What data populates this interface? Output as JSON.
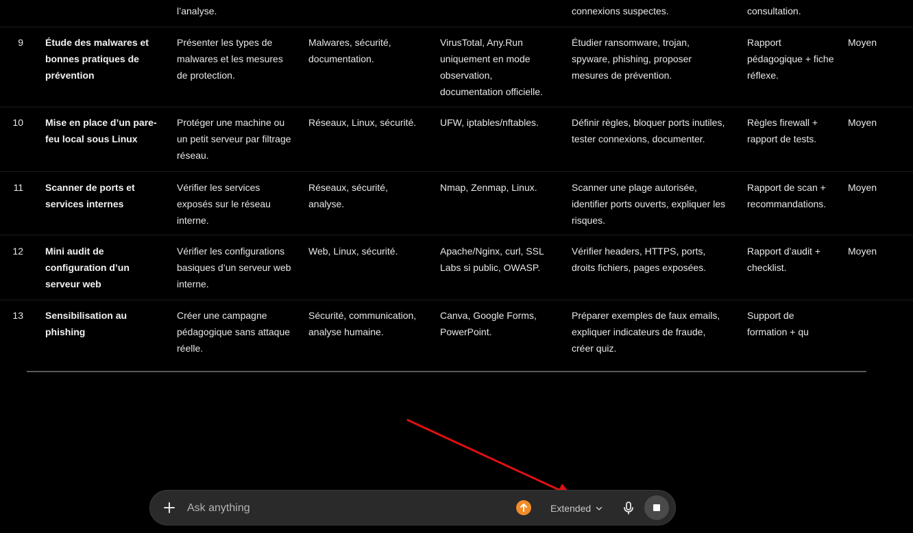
{
  "table": {
    "top_row": {
      "objective": "l’analyse.",
      "steps": "connexions suspectes.",
      "deliverable": "consultation."
    },
    "rows": [
      {
        "num": "9",
        "title": "Étude des malwares et bonnes pratiques de prévention",
        "objective": "Présenter les types de malwares et les mesures de protection.",
        "domains": "Malwares, sécurité, documentation.",
        "tools": "VirusTotal, Any.Run uniquement en mode observation, documentation officielle.",
        "steps": "Étudier ransomware, trojan, spyware, phishing, proposer mesures de prévention.",
        "deliverable": "Rapport pédagogique + fiche réflexe.",
        "level": "Moyen"
      },
      {
        "num": "10",
        "title": "Mise en place d’un pare-feu local sous Linux",
        "objective": "Protéger une machine ou un petit serveur par filtrage réseau.",
        "domains": "Réseaux, Linux, sécurité.",
        "tools": "UFW, iptables/nftables.",
        "steps": "Définir règles, bloquer ports inutiles, tester connexions, documenter.",
        "deliverable": "Règles firewall + rapport de tests.",
        "level": "Moyen"
      },
      {
        "num": "11",
        "title": "Scanner de ports et services internes",
        "objective": "Vérifier les services exposés sur le réseau interne.",
        "domains": "Réseaux, sécurité, analyse.",
        "tools": "Nmap, Zenmap, Linux.",
        "steps": "Scanner une plage autorisée, identifier ports ouverts, expliquer les risques.",
        "deliverable": "Rapport de scan + recommandations.",
        "level": "Moyen"
      },
      {
        "num": "12",
        "title": "Mini audit de configuration d’un serveur web",
        "objective": "Vérifier les configurations basiques d’un serveur web interne.",
        "domains": "Web, Linux, sécurité.",
        "tools": "Apache/Nginx, curl, SSL Labs si public, OWASP.",
        "steps": "Vérifier headers, HTTPS, ports, droits fichiers, pages exposées.",
        "deliverable": "Rapport d’audit + checklist.",
        "level": "Moyen"
      },
      {
        "num": "13",
        "title": "Sensibilisation au phishing",
        "objective": "Créer une campagne pédagogique sans attaque réelle.",
        "domains": "Sécurité, communication, analyse humaine.",
        "tools": "Canva, Google Forms, PowerPoint.",
        "steps": "Préparer exemples de faux emails, expliquer indicateurs de fraude, créer quiz.",
        "deliverable": "Support de formation + qu",
        "level": ""
      }
    ]
  },
  "composer": {
    "placeholder": "Ask anything",
    "mode_label": "Extended",
    "icons": {
      "add": "plus-icon",
      "upload": "arrow-up-icon",
      "mode": "chevron-down-icon",
      "mic": "microphone-icon",
      "stop": "stop-icon"
    },
    "accent_color": "#f28c28"
  },
  "annotation": {
    "arrow_color": "#e01010"
  }
}
